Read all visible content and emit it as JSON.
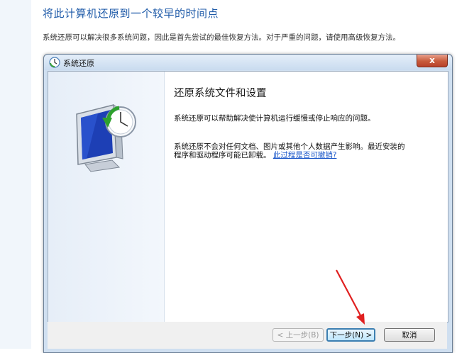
{
  "page": {
    "title": "将此计算机还原到一个较早的时间点",
    "description": "系统还原可以解决很多系统问题，因此是首先尝试的最佳恢复方法。对于严重的问题，请使用高级恢复方法。"
  },
  "dialog": {
    "title": "系统还原",
    "close_label": "x",
    "heading": "还原系统文件和设置",
    "paragraph1": "系统还原可以帮助解决使计算机运行缓慢或停止响应的问题。",
    "paragraph2": "系统还原不会对任何文档、图片或其他个人数据产生影响。最近安装的程序和驱动程序可能已卸载。",
    "link": "此过程是否可撤销?",
    "buttons": {
      "back": "< 上一步(B)",
      "next": "下一步(N) >",
      "cancel": "取消"
    }
  },
  "icons": {
    "title_icon": "system-restore-icon",
    "illustration": "monitor-clock-restore-icon"
  },
  "colors": {
    "title_blue": "#1e5aa8",
    "link_blue": "#1b57c9",
    "annotation_red": "#e02020"
  }
}
